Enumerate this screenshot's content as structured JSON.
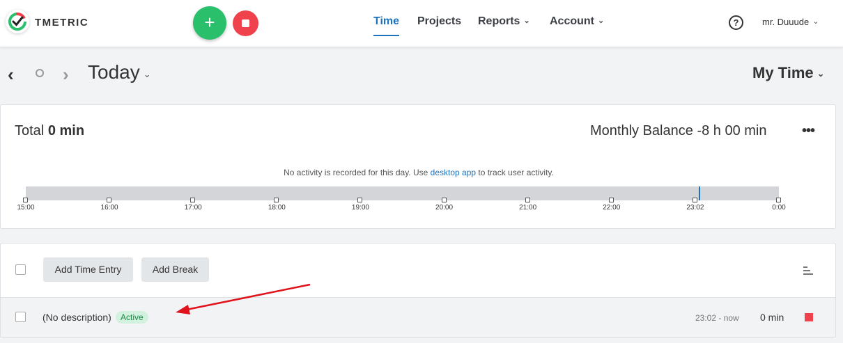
{
  "app": {
    "logo_text": "TMETRIC"
  },
  "nav": {
    "time": "Time",
    "projects": "Projects",
    "reports": "Reports",
    "account": "Account"
  },
  "header": {
    "help": "?",
    "user": "mr. Duuude"
  },
  "datebar": {
    "period": "Today",
    "view": "My Time"
  },
  "summary": {
    "total_label": "Total",
    "total_value": "0 min",
    "balance_label": "Monthly Balance",
    "balance_value": "-8 h 00 min",
    "more": "•••"
  },
  "activity": {
    "note_before": "No activity is recorded for this day. Use ",
    "note_link": "desktop app",
    "note_after": " to track user activity.",
    "ticks": [
      "15:00",
      "16:00",
      "17:00",
      "18:00",
      "19:00",
      "20:00",
      "21:00",
      "22:00",
      "23:02",
      "0:00"
    ]
  },
  "entries_toolbar": {
    "add_entry": "Add Time Entry",
    "add_break": "Add Break"
  },
  "entries": [
    {
      "description": "(No description)",
      "status": "Active",
      "time_range": "23:02 - now",
      "duration": "0 min"
    }
  ],
  "colors": {
    "accent": "#1e73be",
    "start": "#2abf6b",
    "stop": "#f0424d",
    "annotation_arrow": "#e0121b"
  }
}
